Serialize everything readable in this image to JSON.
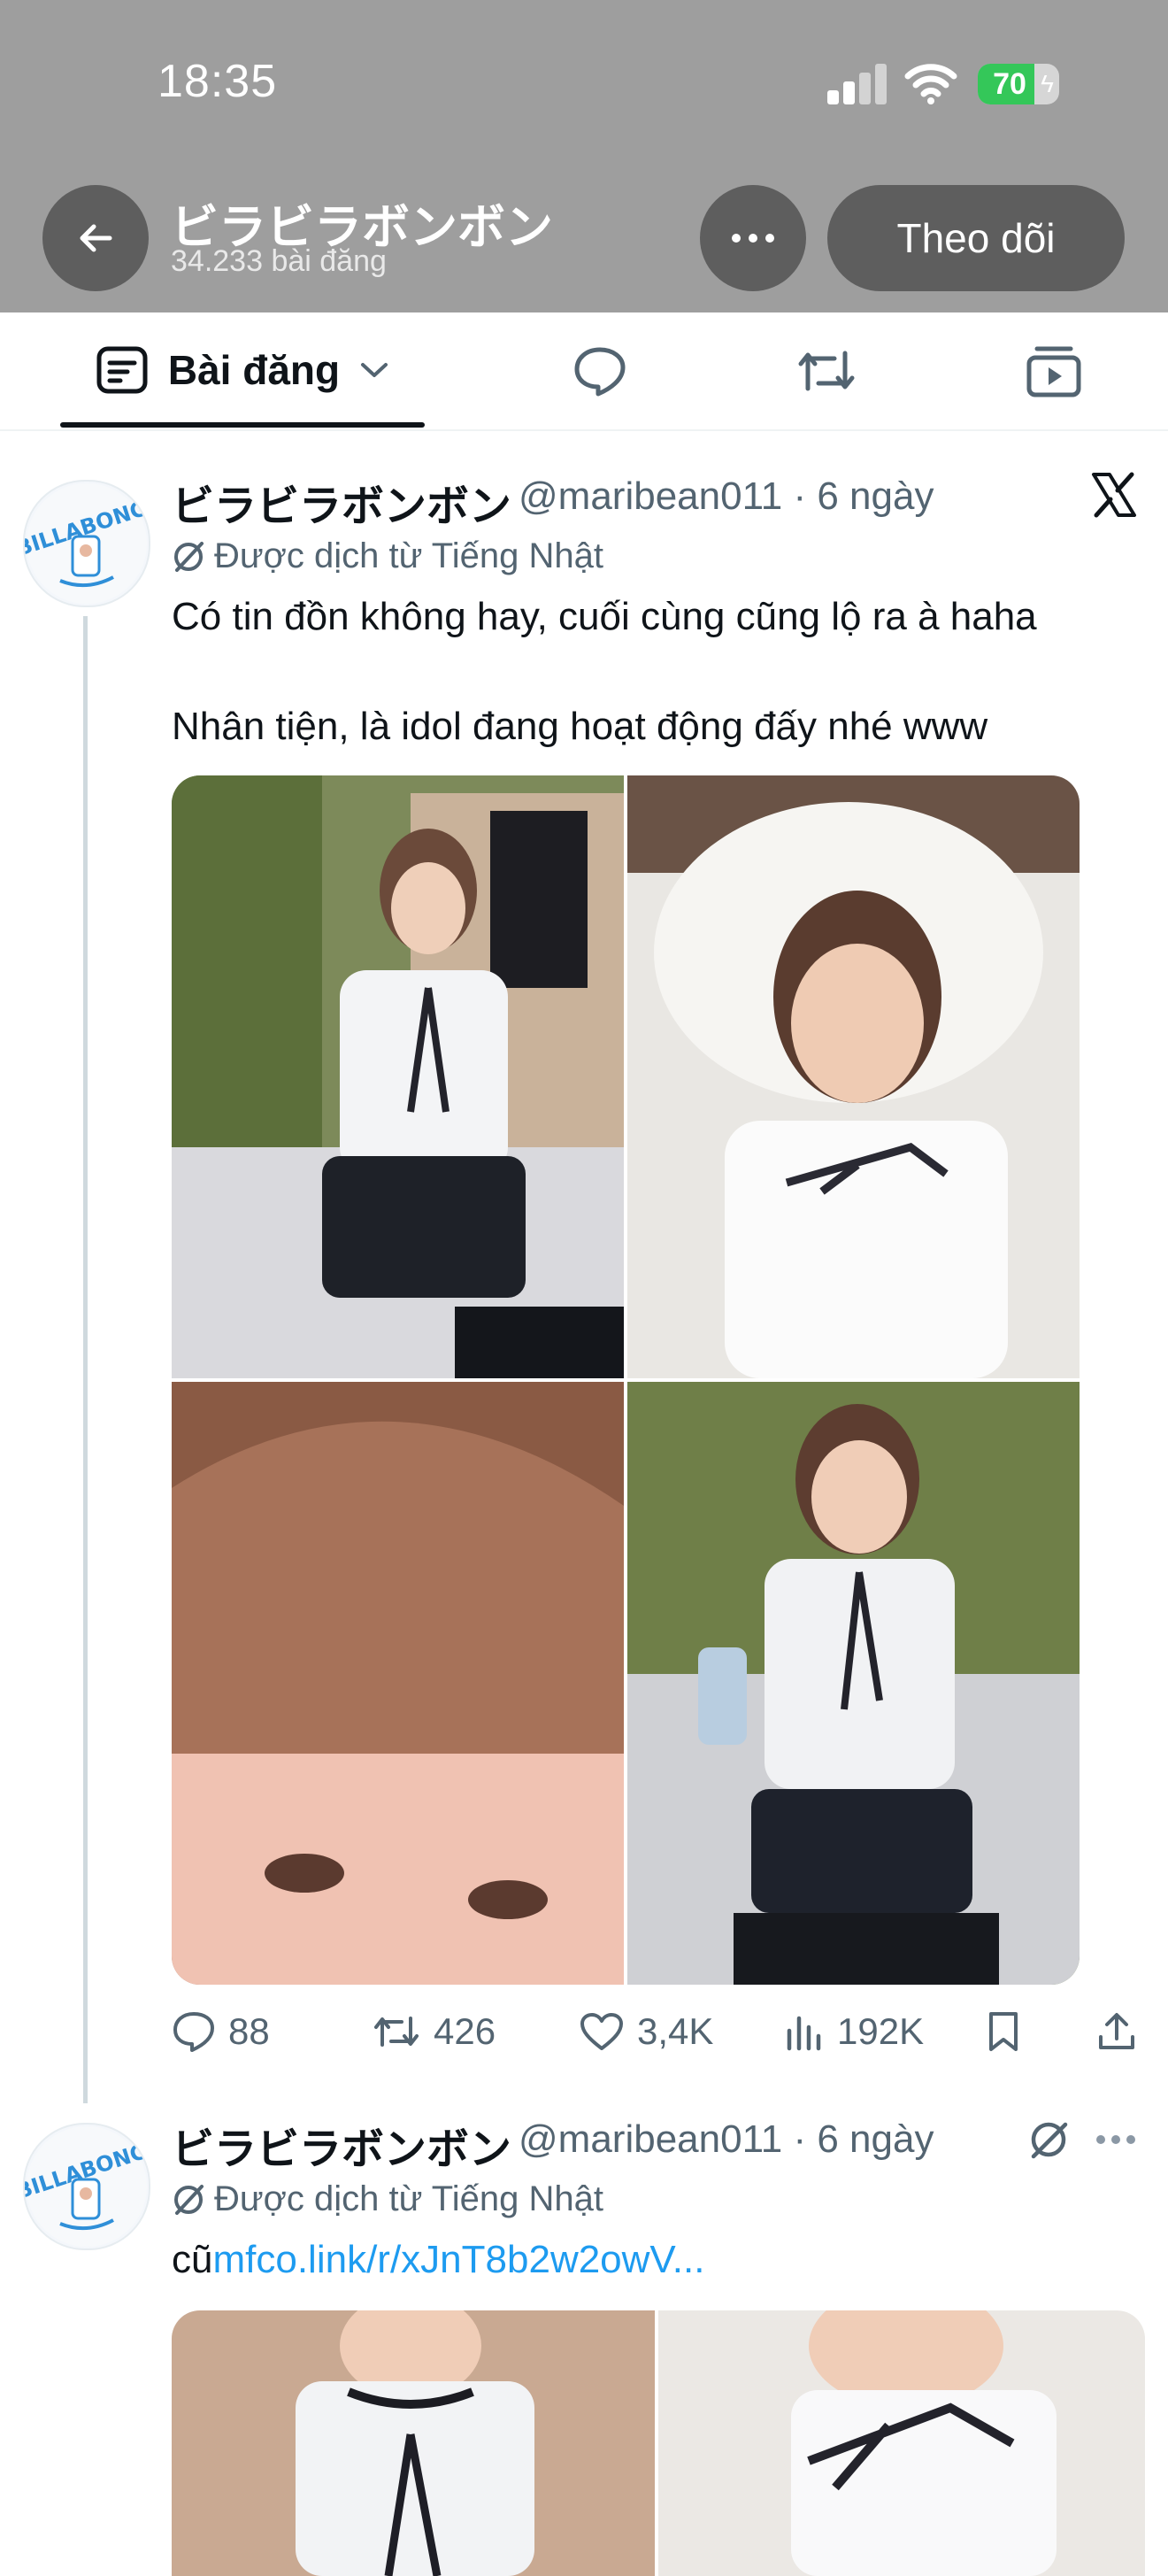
{
  "status_bar": {
    "time": "18:35",
    "battery_percent": "70",
    "battery_level": 0.7,
    "icons": [
      "signal-icon",
      "wifi-icon",
      "battery-icon"
    ]
  },
  "header": {
    "back_icon": "arrow-left-icon",
    "profile_name": "ビラビラボンボン",
    "post_count": "34.233 bài đăng",
    "more_icon": "more-horizontal-icon",
    "follow_label": "Theo dõi"
  },
  "tabs": {
    "posts_label": "Bài đăng",
    "icons": [
      "posts-icon",
      "chevron-down-icon",
      "replies-icon",
      "reposts-icon",
      "videos-icon"
    ]
  },
  "posts": [
    {
      "author": "ビラビラボンボン",
      "meta": "@maribean011 · 6 ngày",
      "translated_label": "Được dịch từ Tiếng Nhật",
      "text": "Có tin đồn không hay, cuối cùng cũng lộ ra à haha\n\nNhân tiện, là idol đang hoạt động đấy nhé www",
      "replies": "88",
      "reposts": "426",
      "likes": "3,4K",
      "views": "192K",
      "corner_icon": "x-logo-icon"
    },
    {
      "author": "ビラビラボンボン",
      "meta": "@maribean011 · 6 ngày",
      "translated_label": "Được dịch từ Tiếng Nhật",
      "text_prefix": "cũ",
      "link": "mfco.link/r/xJnT8b2w2owV...",
      "corner_icon": "translate-icon"
    }
  ],
  "avatar_text": "BILLABONG",
  "colors": {
    "header_bg": "#9e9e9e",
    "button_bg": "#5e5e5e",
    "text_primary": "#0f1419",
    "text_secondary": "#536471",
    "link": "#1d9bf0",
    "battery": "#34c759"
  }
}
